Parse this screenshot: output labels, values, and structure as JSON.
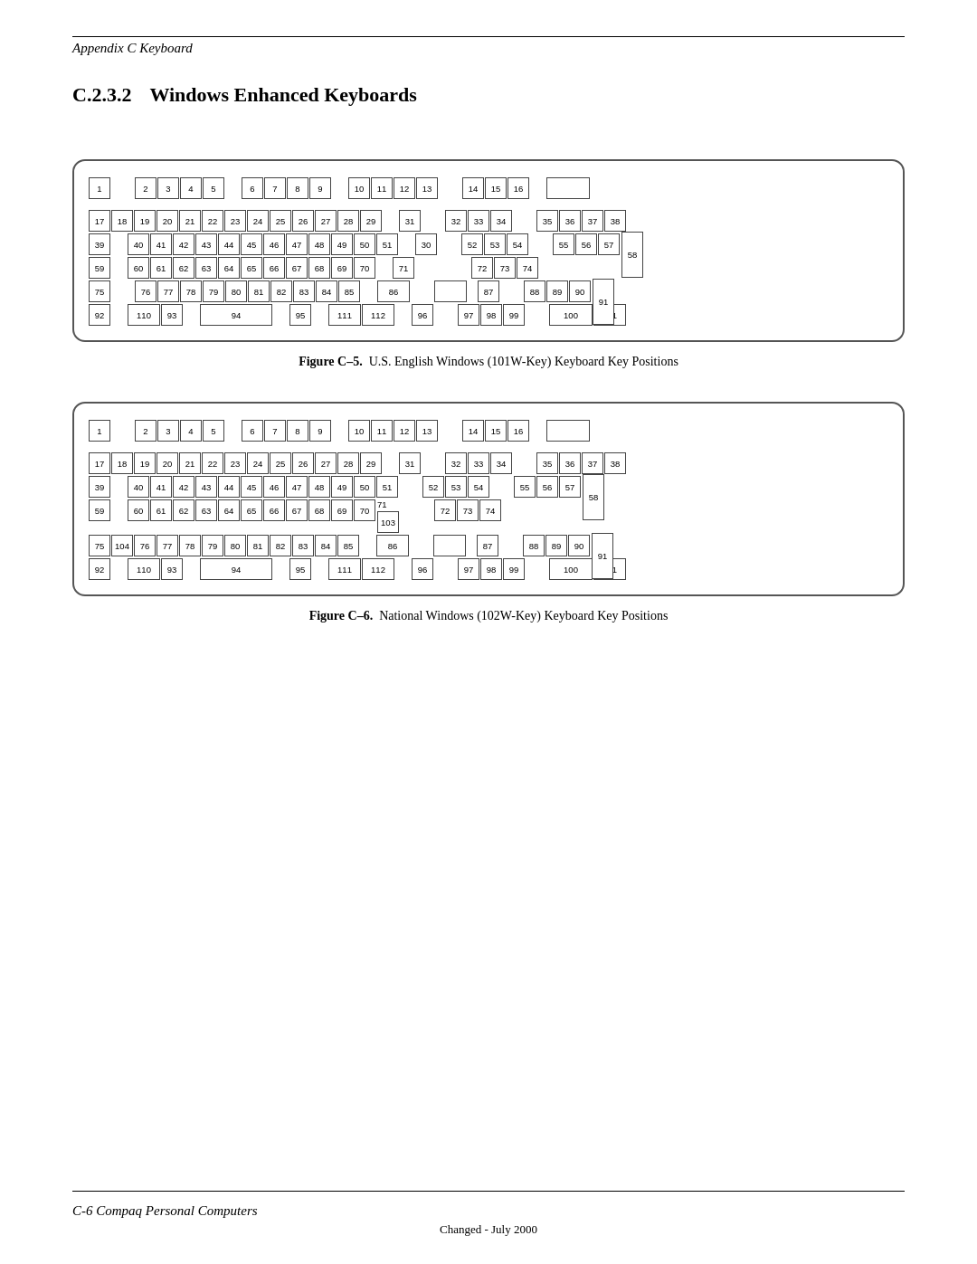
{
  "header": {
    "breadcrumb": "Appendix C  Keyboard"
  },
  "section": {
    "number": "C.2.3.2",
    "title": "Windows Enhanced Keyboards"
  },
  "figure5": {
    "label": "Figure C–5.",
    "caption": "U.S. English Windows (101W-Key) Keyboard Key Positions"
  },
  "figure6": {
    "label": "Figure C–6.",
    "caption": "National Windows (102W-Key) Keyboard Key Positions"
  },
  "footer": {
    "left": "C-6   Compaq Personal Computers",
    "date": "Changed - July 2000"
  }
}
